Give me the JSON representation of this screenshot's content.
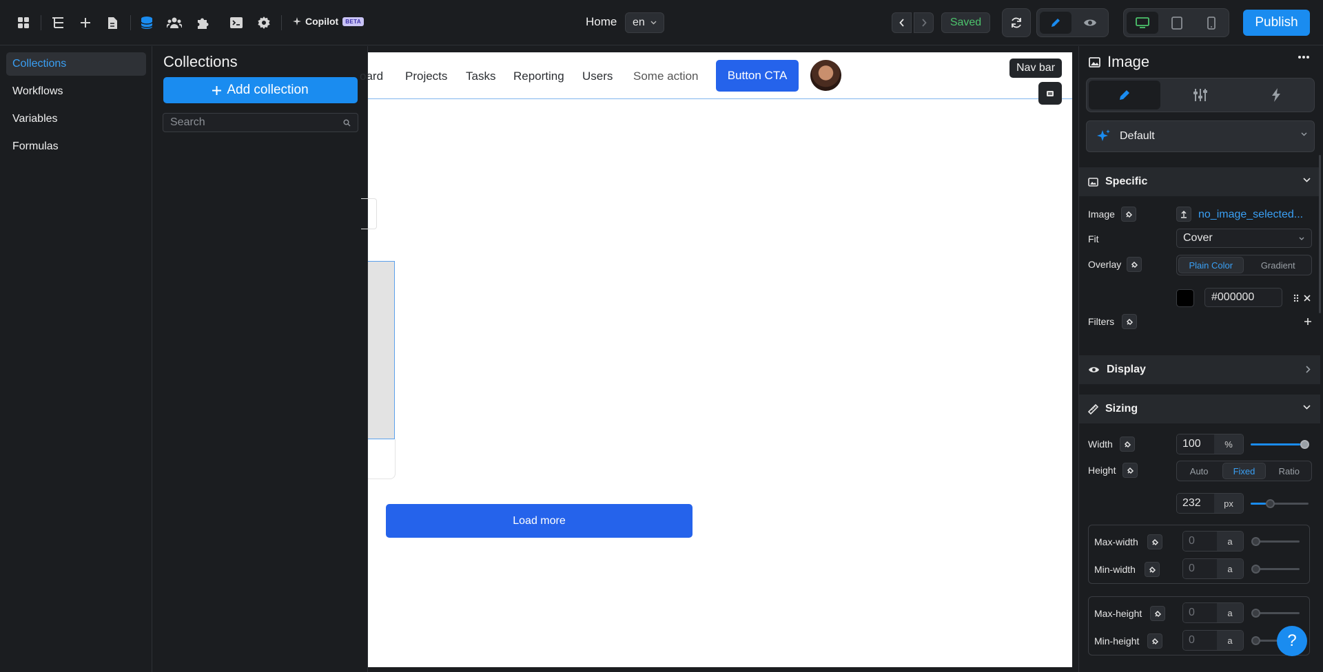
{
  "topbar": {
    "copilot_label": "Copilot",
    "copilot_badge": "BETA",
    "page_name": "Home",
    "language": "en",
    "status": "Saved",
    "publish_label": "Publish"
  },
  "left_nav": {
    "items": [
      {
        "label": "Collections",
        "active": true
      },
      {
        "label": "Workflows",
        "active": false
      },
      {
        "label": "Variables",
        "active": false
      },
      {
        "label": "Formulas",
        "active": false
      }
    ]
  },
  "collections_panel": {
    "title": "Collections",
    "add_button": "Add collection",
    "search_placeholder": "Search"
  },
  "canvas": {
    "nav_links": [
      "oard",
      "Projects",
      "Tasks",
      "Reporting",
      "Users",
      "Some action"
    ],
    "cta_label": "Button CTA",
    "load_more_label": "Load more",
    "selection_tooltip": "Nav bar"
  },
  "right_panel": {
    "title": "Image",
    "preset": "Default",
    "specific": {
      "section_label": "Specific",
      "image_label": "Image",
      "image_value": "no_image_selected...",
      "fit_label": "Fit",
      "fit_value": "Cover",
      "overlay_label": "Overlay",
      "overlay_options": [
        "Plain Color",
        "Gradient"
      ],
      "overlay_selected": "Plain Color",
      "overlay_color": "#000000",
      "filters_label": "Filters"
    },
    "display": {
      "section_label": "Display"
    },
    "sizing": {
      "section_label": "Sizing",
      "width_label": "Width",
      "width_value": "100",
      "width_unit": "%",
      "height_label": "Height",
      "height_modes": [
        "Auto",
        "Fixed",
        "Ratio"
      ],
      "height_mode_selected": "Fixed",
      "height_value": "232",
      "height_unit": "px",
      "max_width_label": "Max-width",
      "max_width_value": "0",
      "min_width_label": "Min-width",
      "min_width_value": "0",
      "max_height_label": "Max-height",
      "max_height_value": "0",
      "min_height_label": "Min-height",
      "min_height_value": "0",
      "auto_unit": "a"
    },
    "help_label": "?"
  },
  "colors": {
    "accent": "#1a8cf0",
    "canvas_primary": "#2563eb",
    "success": "#4cc36c",
    "panel_bg": "#1b1d20"
  }
}
